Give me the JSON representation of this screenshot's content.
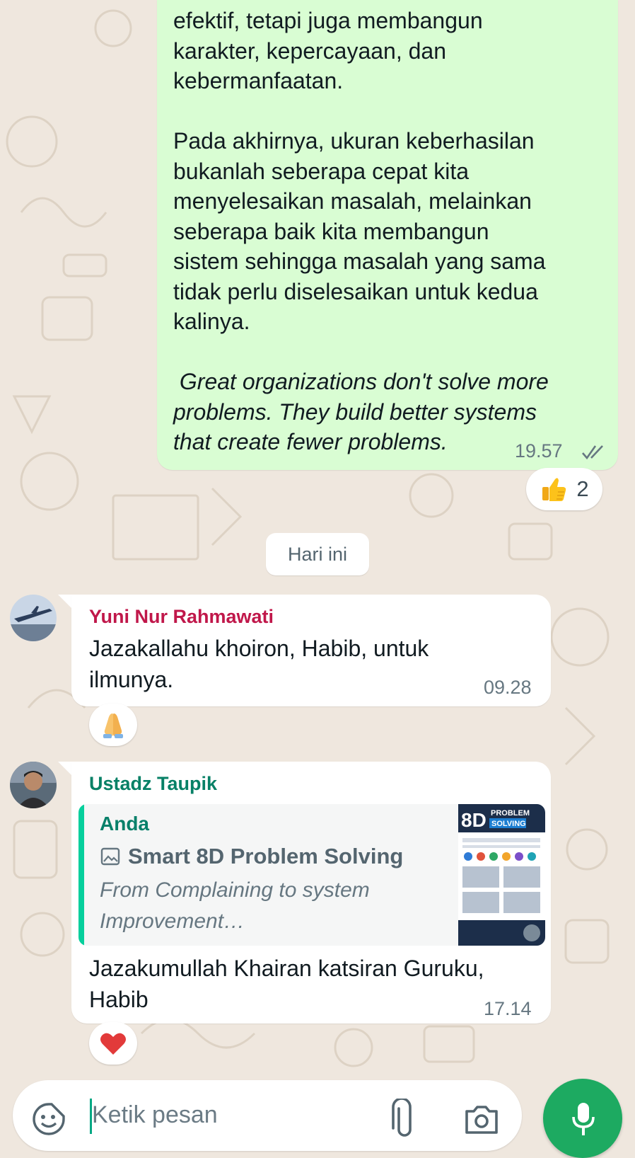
{
  "outgoing": {
    "text_lines": [
      "efektif, tetapi juga membangun",
      "karakter, kepercayaan, dan",
      "kebermanfaatan.",
      "",
      "Pada akhirnya, ukuran keberhasilan",
      "bukanlah seberapa cepat kita",
      "menyelesaikan masalah, melainkan",
      "seberapa baik kita membangun",
      "sistem sehingga masalah yang sama",
      "tidak perlu diselesaikan untuk kedua",
      "kalinya.",
      ""
    ],
    "quote_lines": [
      " Great organizations don't solve more",
      "problems. They build better systems",
      "that create fewer problems."
    ],
    "time": "19.57",
    "reaction_count": "2",
    "reaction_emoji": "thumbs-up"
  },
  "date_divider": "Hari ini",
  "messages": [
    {
      "sender": "Yuni Nur Rahmawati",
      "sender_color": "#c0174a",
      "text": "Jazakallahu khoiron, Habib, untuk ilmunya.",
      "time": "09.28",
      "reaction_emoji": "folded-hands"
    },
    {
      "sender": "Ustadz Taupik",
      "sender_color": "#078066",
      "quote": {
        "author": "Anda",
        "title": "Smart 8D Problem Solving",
        "desc": "From Complaining to system Improvement…",
        "thumb_label_big": "8D",
        "thumb_label_top": "PROBLEM",
        "thumb_label_bottom": "SOLVING"
      },
      "text": "Jazakumullah Khairan katsiran Guruku, Habib",
      "time": "17.14",
      "reaction_emoji": "red-heart"
    }
  ],
  "input": {
    "placeholder": "Ketik pesan"
  },
  "colors": {
    "wallpaper": "#efe7de",
    "outgoing_bubble": "#d9fdd3",
    "send_button": "#1daa61",
    "quote_bar": "#06cf9c"
  }
}
